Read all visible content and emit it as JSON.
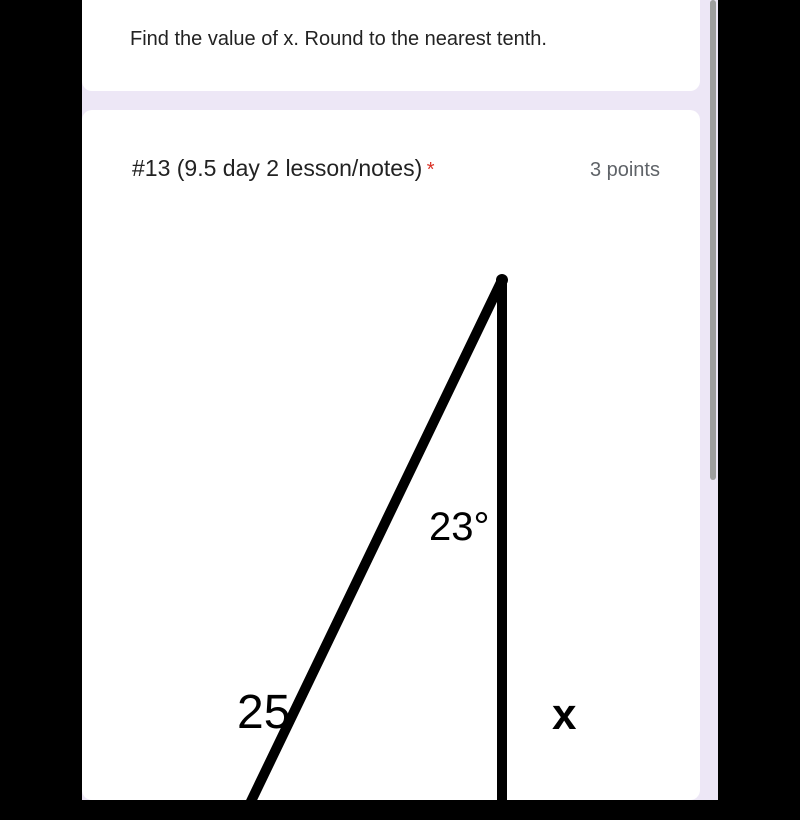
{
  "card1": {
    "instruction": "Find the value of x.  Round to the nearest tenth."
  },
  "card2": {
    "question_title": "#13 (9.5 day 2 lesson/notes)",
    "required_marker": "*",
    "points_text": "3 points"
  },
  "diagram": {
    "angle_label": "23°",
    "hypotenuse_label": "25",
    "unknown_label": "x"
  },
  "chart_data": {
    "type": "diagram",
    "shape": "right-triangle",
    "given_angle_deg": 23,
    "given_side": {
      "label": "hypotenuse",
      "value": 25
    },
    "unknown_side": {
      "label": "adjacent-vertical",
      "symbol": "x"
    },
    "task": "solve for x, round to nearest tenth"
  }
}
